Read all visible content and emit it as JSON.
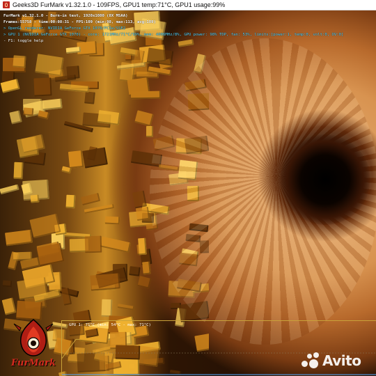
{
  "window": {
    "title": "Geeks3D FurMark v1.32.1.0 - 109FPS, GPU1 temp:71°C, GPU1 usage:99%",
    "icon": "furmark-app-icon"
  },
  "osd": {
    "headline": "FurMark v1.32.1.0 - Burn-in test, 1920x1080 (8X MSAA)",
    "frames": "Frames:55758 - time:00:08:31 - FPS:109 (min:98, max:113, avg:109)",
    "renderer": "> OpenGL renderer: NVIDIA GeForce GTX 1070/PCIe/SSE2",
    "gpu_info": "> GPU 1 (NVIDIA GeForce GTX 1070) - core: 1721MHz/71°C/99%, mem: 4006MHz/8%, GPU power: 98% TDP, fan: 53%, limits:[power:1, temp:0, volt:0, OV:0]",
    "help": "- F1: toggle help"
  },
  "graph": {
    "label": "GPU 1: 71°C (min: 54°C - max: 71°C)",
    "min_temp_c": 54,
    "max_temp_c": 71,
    "current_temp_c": 71,
    "line_color": "#c9a23a"
  },
  "logo": {
    "text": "FurMark"
  },
  "watermark": {
    "text": "Avito"
  },
  "colors": {
    "osd_info": "#4fd3ff",
    "logo_red": "#d42a1e"
  }
}
